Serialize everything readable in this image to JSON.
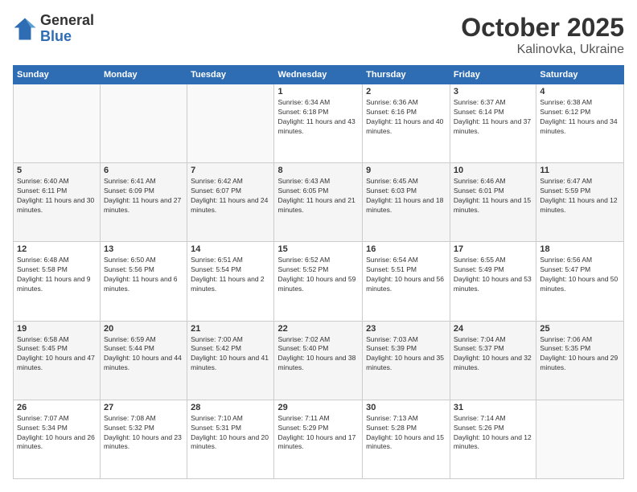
{
  "logo": {
    "general": "General",
    "blue": "Blue"
  },
  "header": {
    "month": "October 2025",
    "location": "Kalinovka, Ukraine"
  },
  "weekdays": [
    "Sunday",
    "Monday",
    "Tuesday",
    "Wednesday",
    "Thursday",
    "Friday",
    "Saturday"
  ],
  "weeks": [
    [
      {
        "day": "",
        "sunrise": "",
        "sunset": "",
        "daylight": ""
      },
      {
        "day": "",
        "sunrise": "",
        "sunset": "",
        "daylight": ""
      },
      {
        "day": "",
        "sunrise": "",
        "sunset": "",
        "daylight": ""
      },
      {
        "day": "1",
        "sunrise": "Sunrise: 6:34 AM",
        "sunset": "Sunset: 6:18 PM",
        "daylight": "Daylight: 11 hours and 43 minutes."
      },
      {
        "day": "2",
        "sunrise": "Sunrise: 6:36 AM",
        "sunset": "Sunset: 6:16 PM",
        "daylight": "Daylight: 11 hours and 40 minutes."
      },
      {
        "day": "3",
        "sunrise": "Sunrise: 6:37 AM",
        "sunset": "Sunset: 6:14 PM",
        "daylight": "Daylight: 11 hours and 37 minutes."
      },
      {
        "day": "4",
        "sunrise": "Sunrise: 6:38 AM",
        "sunset": "Sunset: 6:12 PM",
        "daylight": "Daylight: 11 hours and 34 minutes."
      }
    ],
    [
      {
        "day": "5",
        "sunrise": "Sunrise: 6:40 AM",
        "sunset": "Sunset: 6:11 PM",
        "daylight": "Daylight: 11 hours and 30 minutes."
      },
      {
        "day": "6",
        "sunrise": "Sunrise: 6:41 AM",
        "sunset": "Sunset: 6:09 PM",
        "daylight": "Daylight: 11 hours and 27 minutes."
      },
      {
        "day": "7",
        "sunrise": "Sunrise: 6:42 AM",
        "sunset": "Sunset: 6:07 PM",
        "daylight": "Daylight: 11 hours and 24 minutes."
      },
      {
        "day": "8",
        "sunrise": "Sunrise: 6:43 AM",
        "sunset": "Sunset: 6:05 PM",
        "daylight": "Daylight: 11 hours and 21 minutes."
      },
      {
        "day": "9",
        "sunrise": "Sunrise: 6:45 AM",
        "sunset": "Sunset: 6:03 PM",
        "daylight": "Daylight: 11 hours and 18 minutes."
      },
      {
        "day": "10",
        "sunrise": "Sunrise: 6:46 AM",
        "sunset": "Sunset: 6:01 PM",
        "daylight": "Daylight: 11 hours and 15 minutes."
      },
      {
        "day": "11",
        "sunrise": "Sunrise: 6:47 AM",
        "sunset": "Sunset: 5:59 PM",
        "daylight": "Daylight: 11 hours and 12 minutes."
      }
    ],
    [
      {
        "day": "12",
        "sunrise": "Sunrise: 6:48 AM",
        "sunset": "Sunset: 5:58 PM",
        "daylight": "Daylight: 11 hours and 9 minutes."
      },
      {
        "day": "13",
        "sunrise": "Sunrise: 6:50 AM",
        "sunset": "Sunset: 5:56 PM",
        "daylight": "Daylight: 11 hours and 6 minutes."
      },
      {
        "day": "14",
        "sunrise": "Sunrise: 6:51 AM",
        "sunset": "Sunset: 5:54 PM",
        "daylight": "Daylight: 11 hours and 2 minutes."
      },
      {
        "day": "15",
        "sunrise": "Sunrise: 6:52 AM",
        "sunset": "Sunset: 5:52 PM",
        "daylight": "Daylight: 10 hours and 59 minutes."
      },
      {
        "day": "16",
        "sunrise": "Sunrise: 6:54 AM",
        "sunset": "Sunset: 5:51 PM",
        "daylight": "Daylight: 10 hours and 56 minutes."
      },
      {
        "day": "17",
        "sunrise": "Sunrise: 6:55 AM",
        "sunset": "Sunset: 5:49 PM",
        "daylight": "Daylight: 10 hours and 53 minutes."
      },
      {
        "day": "18",
        "sunrise": "Sunrise: 6:56 AM",
        "sunset": "Sunset: 5:47 PM",
        "daylight": "Daylight: 10 hours and 50 minutes."
      }
    ],
    [
      {
        "day": "19",
        "sunrise": "Sunrise: 6:58 AM",
        "sunset": "Sunset: 5:45 PM",
        "daylight": "Daylight: 10 hours and 47 minutes."
      },
      {
        "day": "20",
        "sunrise": "Sunrise: 6:59 AM",
        "sunset": "Sunset: 5:44 PM",
        "daylight": "Daylight: 10 hours and 44 minutes."
      },
      {
        "day": "21",
        "sunrise": "Sunrise: 7:00 AM",
        "sunset": "Sunset: 5:42 PM",
        "daylight": "Daylight: 10 hours and 41 minutes."
      },
      {
        "day": "22",
        "sunrise": "Sunrise: 7:02 AM",
        "sunset": "Sunset: 5:40 PM",
        "daylight": "Daylight: 10 hours and 38 minutes."
      },
      {
        "day": "23",
        "sunrise": "Sunrise: 7:03 AM",
        "sunset": "Sunset: 5:39 PM",
        "daylight": "Daylight: 10 hours and 35 minutes."
      },
      {
        "day": "24",
        "sunrise": "Sunrise: 7:04 AM",
        "sunset": "Sunset: 5:37 PM",
        "daylight": "Daylight: 10 hours and 32 minutes."
      },
      {
        "day": "25",
        "sunrise": "Sunrise: 7:06 AM",
        "sunset": "Sunset: 5:35 PM",
        "daylight": "Daylight: 10 hours and 29 minutes."
      }
    ],
    [
      {
        "day": "26",
        "sunrise": "Sunrise: 7:07 AM",
        "sunset": "Sunset: 5:34 PM",
        "daylight": "Daylight: 10 hours and 26 minutes."
      },
      {
        "day": "27",
        "sunrise": "Sunrise: 7:08 AM",
        "sunset": "Sunset: 5:32 PM",
        "daylight": "Daylight: 10 hours and 23 minutes."
      },
      {
        "day": "28",
        "sunrise": "Sunrise: 7:10 AM",
        "sunset": "Sunset: 5:31 PM",
        "daylight": "Daylight: 10 hours and 20 minutes."
      },
      {
        "day": "29",
        "sunrise": "Sunrise: 7:11 AM",
        "sunset": "Sunset: 5:29 PM",
        "daylight": "Daylight: 10 hours and 17 minutes."
      },
      {
        "day": "30",
        "sunrise": "Sunrise: 7:13 AM",
        "sunset": "Sunset: 5:28 PM",
        "daylight": "Daylight: 10 hours and 15 minutes."
      },
      {
        "day": "31",
        "sunrise": "Sunrise: 7:14 AM",
        "sunset": "Sunset: 5:26 PM",
        "daylight": "Daylight: 10 hours and 12 minutes."
      },
      {
        "day": "",
        "sunrise": "",
        "sunset": "",
        "daylight": ""
      }
    ]
  ]
}
